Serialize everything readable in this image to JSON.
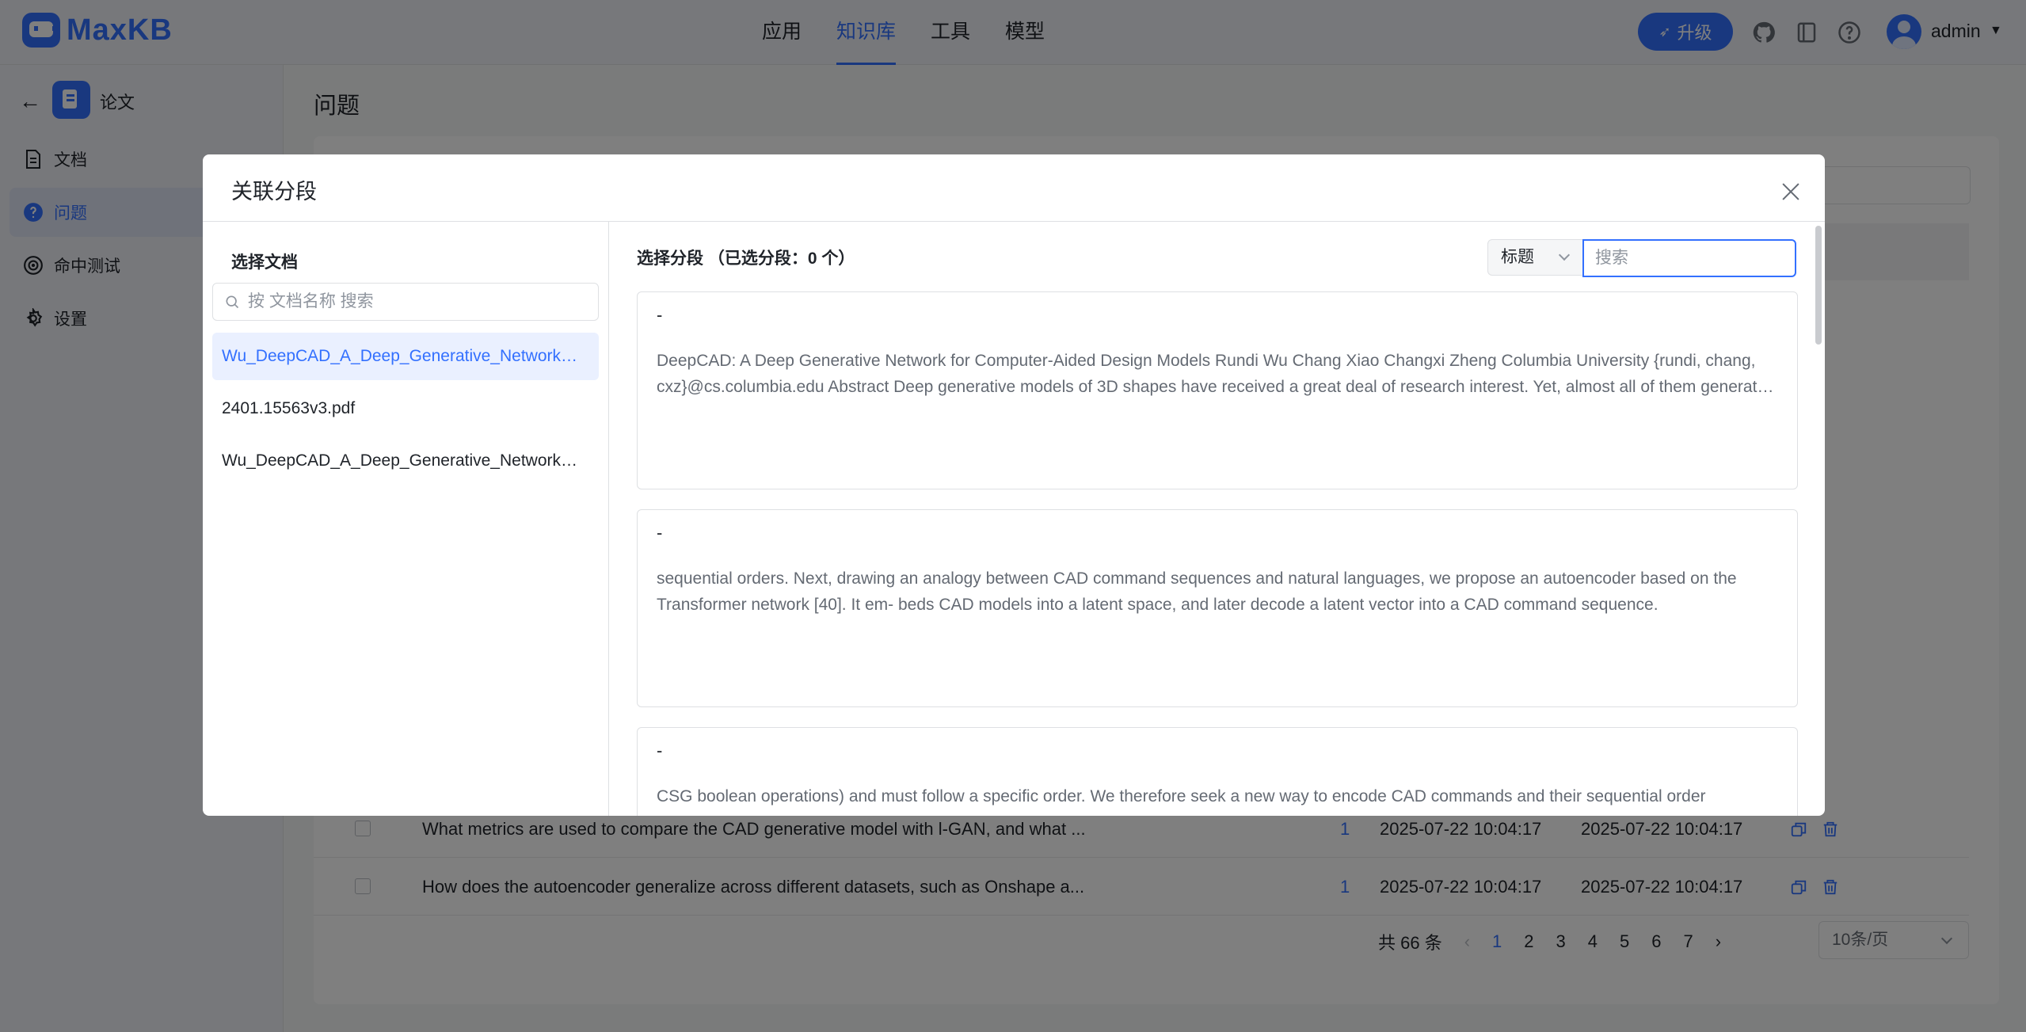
{
  "brand": {
    "name": "MaxKB"
  },
  "nav": {
    "items": [
      "应用",
      "知识库",
      "工具",
      "模型"
    ],
    "active": "知识库"
  },
  "header": {
    "upgrade_label": "升级",
    "user": "admin"
  },
  "sidebar": {
    "kb_name": "论文",
    "items": [
      {
        "label": "文档",
        "icon": "document-icon"
      },
      {
        "label": "问题",
        "icon": "question-icon"
      },
      {
        "label": "命中测试",
        "icon": "target-icon"
      },
      {
        "label": "设置",
        "icon": "gear-icon"
      }
    ],
    "active": "问题"
  },
  "main": {
    "title": "问题",
    "rows": [
      {
        "question": "What metrics are used to compare the CAD generative model with l-GAN, and what ...",
        "count": "1",
        "created": "2025-07-22 10:04:17",
        "updated": "2025-07-22 10:04:17"
      },
      {
        "question": "How does the autoencoder generalize across different datasets, such as Onshape a...",
        "count": "1",
        "created": "2025-07-22 10:04:17",
        "updated": "2025-07-22 10:04:17"
      }
    ],
    "pagination": {
      "total": "共 66 条",
      "pages": [
        "1",
        "2",
        "3",
        "4",
        "5",
        "6",
        "7"
      ],
      "current": "1",
      "page_size": "10条/页"
    }
  },
  "dialog": {
    "title": "关联分段",
    "left": {
      "label": "选择文档",
      "search_placeholder": "按 文档名称 搜索",
      "documents": [
        "Wu_DeepCAD_A_Deep_Generative_Network_for_Computer-Aided_Design_Models.pdf",
        "2401.15563v3.pdf",
        "Wu_DeepCAD_A_Deep_Generative_Network_for_Computer-Aided_Design_Models.pdf"
      ],
      "active_index": 0
    },
    "right": {
      "label": "选择分段",
      "selected_info": "（已选分段：0 个）",
      "filter_value": "标题",
      "search_placeholder": "搜索",
      "segments": [
        {
          "title": "-",
          "content": "DeepCAD: A Deep Generative Network for Computer-Aided Design Models Rundi Wu Chang Xiao Changxi Zheng Columbia University {rundi, chang, cxz}@cs.columbia.edu Abstract Deep generative models of 3D shapes have received a great deal of research interest. Yet, almost all of them generate discrete shape representations, such as voxels, point clouds, and polygon meshes."
        },
        {
          "title": "-",
          "content": "sequential orders. Next, drawing an analogy between CAD command sequences and natural languages, we propose an autoencoder based on the Transformer network [40]. It em- beds CAD models into a latent space, and later decode a latent vector into a CAD command sequence."
        },
        {
          "title": "-",
          "content": "CSG boolean operations) and must follow a specific order. We therefore seek a new way to encode CAD commands and their sequential order"
        }
      ]
    }
  },
  "colors": {
    "primary": "#3370ff",
    "overlay": "rgba(0,0,0,0.5)"
  }
}
